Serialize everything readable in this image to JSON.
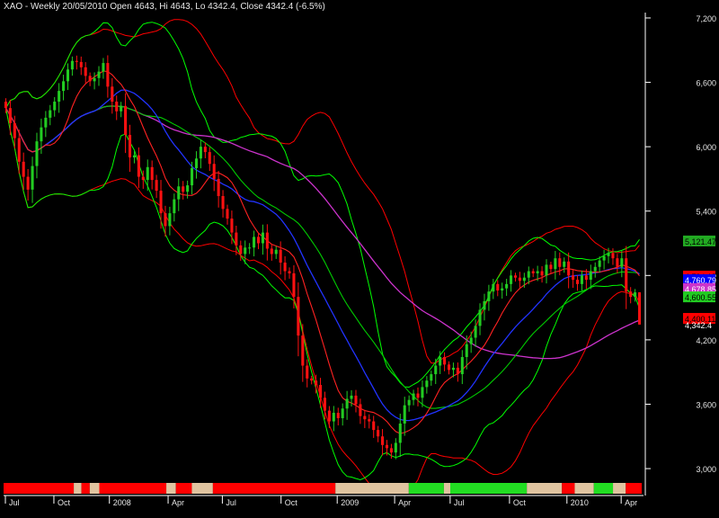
{
  "header": {
    "title": "XAO - Weekly 20/05/2010 Open 4643, Hi 4643, Lo 4342.4, Close 4342.4 (-6.5%)"
  },
  "chart_data": {
    "type": "candlestick",
    "symbol": "XAO",
    "period": "Weekly",
    "last_bar": {
      "date": "20/05/2010",
      "open": 4643,
      "high": 4643,
      "low": 4342.4,
      "close": 4342.4,
      "change_pct": -6.5
    },
    "ylim": [
      2900,
      7250
    ],
    "yticks": [
      {
        "value": 3000,
        "label": "3,000"
      },
      {
        "value": 3600,
        "label": "3,600"
      },
      {
        "value": 4200,
        "label": "4,200"
      },
      {
        "value": 4800,
        "label": "4,800"
      },
      {
        "value": 5400,
        "label": "5,400"
      },
      {
        "value": 6000,
        "label": "6,000"
      },
      {
        "value": 6600,
        "label": "6,600"
      },
      {
        "value": 7200,
        "label": "7,200"
      }
    ],
    "xticks": [
      {
        "pos": 0.0,
        "label": "Jul"
      },
      {
        "pos": 0.076,
        "label": "Oct"
      },
      {
        "pos": 0.163,
        "label": "2008"
      },
      {
        "pos": 0.255,
        "label": "Apr"
      },
      {
        "pos": 0.34,
        "label": "Jul"
      },
      {
        "pos": 0.432,
        "label": "Oct"
      },
      {
        "pos": 0.52,
        "label": "2009"
      },
      {
        "pos": 0.61,
        "label": "Apr"
      },
      {
        "pos": 0.697,
        "label": "Jul"
      },
      {
        "pos": 0.79,
        "label": "Oct"
      },
      {
        "pos": 0.88,
        "label": "2010"
      },
      {
        "pos": 0.965,
        "label": "Apr"
      }
    ],
    "price_labels": [
      {
        "value": 5121.47,
        "label": "5,121.47",
        "bg": "#22aa22",
        "fg": "#000000"
      },
      {
        "value": 4794.15,
        "label": "4,794.15",
        "bg": "#ff0000",
        "fg": "#000000"
      },
      {
        "value": 4760.79,
        "label": "4,760.79",
        "bg": "#0000ff",
        "fg": "#ffffff"
      },
      {
        "value": 4678.85,
        "label": "4,678.85",
        "bg": "#cc33cc",
        "fg": "#ffffff"
      },
      {
        "value": 4600.55,
        "label": "4,600.55",
        "bg": "#22cc22",
        "fg": "#000000"
      },
      {
        "value": 4400.11,
        "label": "4,400.11",
        "bg": "#ff0000",
        "fg": "#000000"
      },
      {
        "value": 4342.4,
        "label": "4,342.4",
        "bg": "",
        "fg": "#ffffff"
      }
    ],
    "closes": [
      6360,
      6220,
      6080,
      5860,
      5720,
      5600,
      5820,
      6050,
      6180,
      6270,
      6340,
      6420,
      6520,
      6610,
      6720,
      6800,
      6790,
      6740,
      6660,
      6610,
      6640,
      6700,
      6780,
      6560,
      6420,
      6330,
      6380,
      6110,
      5900,
      5920,
      5720,
      5690,
      5810,
      5690,
      5590,
      5380,
      5260,
      5380,
      5510,
      5630,
      5580,
      5640,
      5800,
      5890,
      6000,
      5950,
      5840,
      5700,
      5540,
      5420,
      5330,
      5200,
      5080,
      5000,
      5060,
      5060,
      5160,
      5100,
      5200,
      5050,
      5000,
      5040,
      4920,
      4840,
      4820,
      4600,
      4240,
      3960,
      3840,
      3820,
      3780,
      3660,
      3540,
      3440,
      3520,
      3470,
      3560,
      3650,
      3680,
      3600,
      3490,
      3460,
      3440,
      3360,
      3300,
      3220,
      3190,
      3150,
      3240,
      3420,
      3590,
      3640,
      3700,
      3660,
      3760,
      3820,
      3880,
      3960,
      4040,
      3970,
      3920,
      3940,
      3880,
      4040,
      4160,
      4220,
      4330,
      4480,
      4560,
      4650,
      4720,
      4660,
      4680,
      4720,
      4800,
      4780,
      4750,
      4780,
      4840,
      4820,
      4840,
      4800,
      4900,
      4860,
      4960,
      4880,
      4930,
      4800,
      4760,
      4720,
      4800,
      4760,
      4840,
      4880,
      4940,
      4980,
      5010,
      4960,
      4880,
      4960,
      4650,
      4600,
      4643,
      4342
    ],
    "indicators": [
      {
        "name": "Upper Bollinger Band",
        "color": "#00ff00"
      },
      {
        "name": "Lower Bollinger Band",
        "color": "#00ff00"
      },
      {
        "name": "Upper envelope",
        "color": "#ff0000"
      },
      {
        "name": "Lower envelope",
        "color": "#ff0000"
      },
      {
        "name": "Short MA",
        "color": "#ff2222"
      },
      {
        "name": "Medium MA",
        "color": "#2222ff"
      },
      {
        "name": "Long MA",
        "color": "#00cc00"
      },
      {
        "name": "Very long MA",
        "color": "#cc33cc"
      }
    ],
    "trend_strip": [
      {
        "start": 0.0,
        "end": 0.11,
        "color": "#ff0000"
      },
      {
        "start": 0.11,
        "end": 0.122,
        "color": "#e0c4a0"
      },
      {
        "start": 0.122,
        "end": 0.135,
        "color": "#ff0000"
      },
      {
        "start": 0.135,
        "end": 0.15,
        "color": "#e0c4a0"
      },
      {
        "start": 0.15,
        "end": 0.255,
        "color": "#ff0000"
      },
      {
        "start": 0.255,
        "end": 0.27,
        "color": "#e0c4a0"
      },
      {
        "start": 0.27,
        "end": 0.295,
        "color": "#ff0000"
      },
      {
        "start": 0.295,
        "end": 0.328,
        "color": "#e0c4a0"
      },
      {
        "start": 0.328,
        "end": 0.52,
        "color": "#ff0000"
      },
      {
        "start": 0.52,
        "end": 0.635,
        "color": "#e0c4a0"
      },
      {
        "start": 0.635,
        "end": 0.69,
        "color": "#22dd22"
      },
      {
        "start": 0.69,
        "end": 0.7,
        "color": "#e0c4a0"
      },
      {
        "start": 0.7,
        "end": 0.82,
        "color": "#22dd22"
      },
      {
        "start": 0.82,
        "end": 0.875,
        "color": "#e0c4a0"
      },
      {
        "start": 0.875,
        "end": 0.895,
        "color": "#ff0000"
      },
      {
        "start": 0.895,
        "end": 0.925,
        "color": "#e0c4a0"
      },
      {
        "start": 0.925,
        "end": 0.955,
        "color": "#22dd22"
      },
      {
        "start": 0.955,
        "end": 0.975,
        "color": "#e0c4a0"
      },
      {
        "start": 0.975,
        "end": 1.0,
        "color": "#ff0000"
      }
    ],
    "colors": {
      "background": "#000000",
      "up": "#22cc22",
      "down": "#ff1111",
      "axis": "#ffffff"
    },
    "grid": false
  }
}
